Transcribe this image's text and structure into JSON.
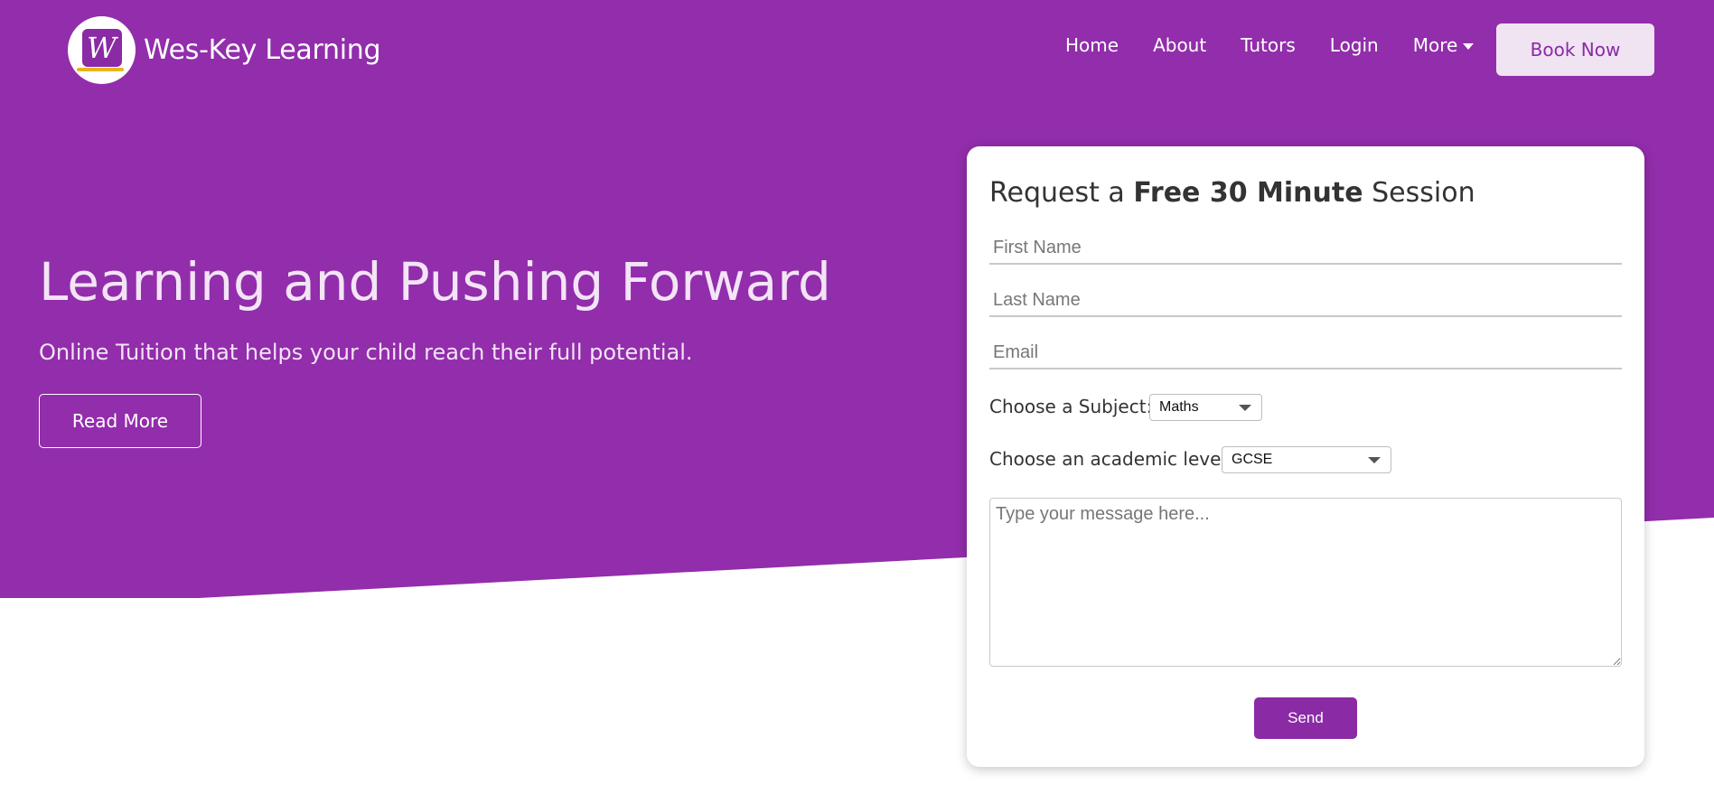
{
  "colors": {
    "hero_bg": "#922dab",
    "primary": "#8a2aa5",
    "book_now_bg": "#f0e3f2",
    "white": "#ffffff"
  },
  "header": {
    "brand": "Wes-Key Learning",
    "logo_letter": "W",
    "nav": [
      {
        "label": "Home"
      },
      {
        "label": "About"
      },
      {
        "label": "Tutors"
      },
      {
        "label": "Login"
      },
      {
        "label": "More",
        "icon": "caret-down-icon"
      }
    ],
    "cta_label": "Book Now"
  },
  "hero": {
    "title": "Learning and Pushing Forward",
    "subtitle": "Online Tuition that helps your child reach their full potential.",
    "button_label": "Read More"
  },
  "form": {
    "title_prefix": "Request a ",
    "title_bold": "Free 30 Minute",
    "title_suffix": " Session",
    "first_name_placeholder": "First Name",
    "last_name_placeholder": "Last Name",
    "email_placeholder": "Email",
    "subject_label": "Choose a Subject:",
    "subject_value": "Maths",
    "level_label": "Choose an academic level:",
    "level_value": "GCSE",
    "message_placeholder": "Type your message here...",
    "send_label": "Send"
  }
}
